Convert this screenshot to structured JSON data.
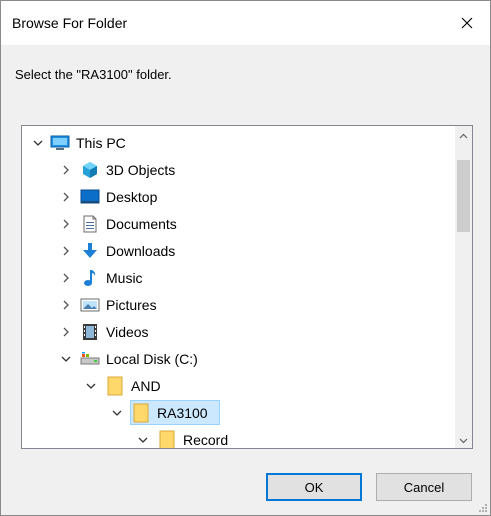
{
  "window": {
    "title": "Browse For Folder",
    "close_icon": "close-icon"
  },
  "instruction": "Select the \"RA3100\" folder.",
  "tree": {
    "items": [
      {
        "label": "This PC",
        "icon": "computer-icon",
        "expanded": true,
        "level": 0
      },
      {
        "label": "3D Objects",
        "icon": "3d-objects-icon",
        "expanded": false,
        "level": 1
      },
      {
        "label": "Desktop",
        "icon": "desktop-icon",
        "expanded": false,
        "level": 1
      },
      {
        "label": "Documents",
        "icon": "documents-icon",
        "expanded": false,
        "level": 1
      },
      {
        "label": "Downloads",
        "icon": "downloads-icon",
        "expanded": false,
        "level": 1
      },
      {
        "label": "Music",
        "icon": "music-icon",
        "expanded": false,
        "level": 1
      },
      {
        "label": "Pictures",
        "icon": "pictures-icon",
        "expanded": false,
        "level": 1
      },
      {
        "label": "Videos",
        "icon": "videos-icon",
        "expanded": false,
        "level": 1
      },
      {
        "label": "Local Disk (C:)",
        "icon": "drive-icon",
        "expanded": true,
        "level": 1
      },
      {
        "label": "AND",
        "icon": "folder-icon",
        "expanded": true,
        "level": 2
      },
      {
        "label": "RA3100",
        "icon": "folder-icon",
        "expanded": true,
        "level": 3,
        "selected": true
      },
      {
        "label": "Record",
        "icon": "folder-icon",
        "expanded": true,
        "level": 4
      }
    ]
  },
  "buttons": {
    "ok": "OK",
    "cancel": "Cancel"
  },
  "colors": {
    "selection_bg": "#cce8ff",
    "selection_border": "#99d1ff",
    "folder_yellow": "#ffd86b",
    "accent": "#0078d7"
  }
}
